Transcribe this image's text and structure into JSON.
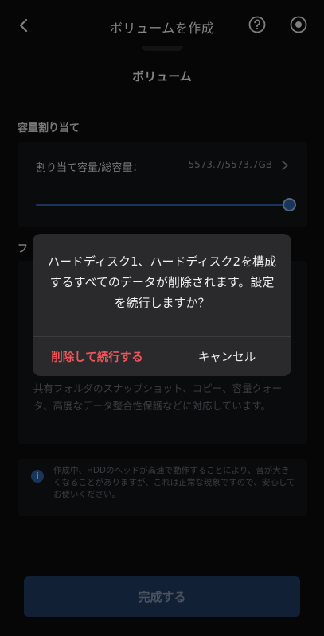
{
  "header": {
    "title": "ボリュームを作成"
  },
  "section_title": "ボリューム",
  "capacity": {
    "section_label": "容量割り当て",
    "field_label": "割り当て容量/総容量：",
    "value": "5573.7/5573.7GB",
    "slider_fraction": 1.0
  },
  "folder": {
    "section_label": "フ",
    "description": "共有フォルダのスナップショット、コピー、容量クォータ、高度なデータ整合性保護などに対応しています。"
  },
  "note": {
    "icon": "info-icon",
    "icon_glyph": "i",
    "text": "作成中、HDDのヘッドが高速で動作することにより、音が大きくなることがありますが、これは正常な現象ですので、安心してお使いください。"
  },
  "complete_button": "完成する",
  "dialog": {
    "message": "ハードディスク1、ハードディスク2を構成するすべてのデータが削除されます。設定を続行しますか？",
    "confirm_label": "削除して続行する",
    "cancel_label": "キャンセル"
  },
  "colors": {
    "accent": "#2f62a8",
    "danger": "#f0555a",
    "background": "#0b0b0c",
    "dialog": "#2a2a2c"
  }
}
